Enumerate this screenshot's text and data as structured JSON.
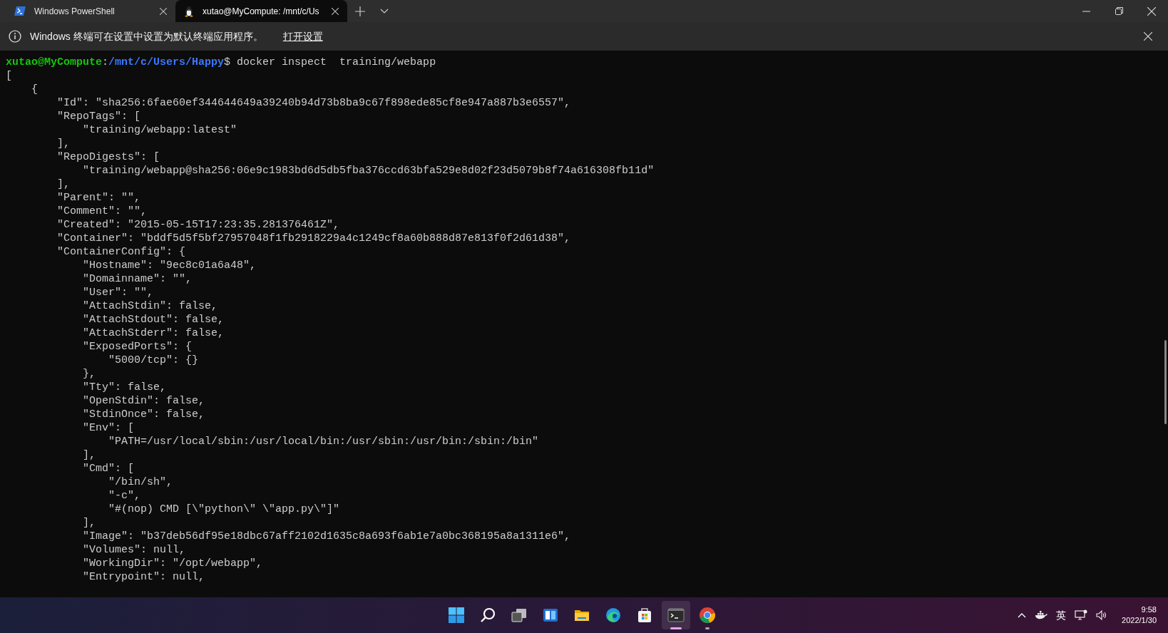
{
  "tabs": [
    {
      "kind": "powershell",
      "title": "Windows PowerShell",
      "selected": false
    },
    {
      "kind": "linux",
      "title": "xutao@MyCompute: /mnt/c/Us",
      "selected": true
    }
  ],
  "info_bar": {
    "message": "Windows 终端可在设置中设置为默认终端应用程序。",
    "link": "打开设置"
  },
  "terminal": {
    "prompt": {
      "user": "xutao@MyCompute",
      "separator": ":",
      "path": "/mnt/c/Users/Happy",
      "command": "$ docker inspect  training/webapp"
    },
    "lines": [
      "[",
      "    {",
      "        \"Id\": \"sha256:6fae60ef344644649a39240b94d73b8ba9c67f898ede85cf8e947a887b3e6557\",",
      "        \"RepoTags\": [",
      "            \"training/webapp:latest\"",
      "        ],",
      "        \"RepoDigests\": [",
      "            \"training/webapp@sha256:06e9c1983bd6d5db5fba376ccd63bfa529e8d02f23d5079b8f74a616308fb11d\"",
      "        ],",
      "        \"Parent\": \"\",",
      "        \"Comment\": \"\",",
      "        \"Created\": \"2015-05-15T17:23:35.281376461Z\",",
      "        \"Container\": \"bddf5d5f5bf27957048f1fb2918229a4c1249cf8a60b888d87e813f0f2d61d38\",",
      "        \"ContainerConfig\": {",
      "            \"Hostname\": \"9ec8c01a6a48\",",
      "            \"Domainname\": \"\",",
      "            \"User\": \"\",",
      "            \"AttachStdin\": false,",
      "            \"AttachStdout\": false,",
      "            \"AttachStderr\": false,",
      "            \"ExposedPorts\": {",
      "                \"5000/tcp\": {}",
      "            },",
      "            \"Tty\": false,",
      "            \"OpenStdin\": false,",
      "            \"StdinOnce\": false,",
      "            \"Env\": [",
      "                \"PATH=/usr/local/sbin:/usr/local/bin:/usr/sbin:/usr/bin:/sbin:/bin\"",
      "            ],",
      "            \"Cmd\": [",
      "                \"/bin/sh\",",
      "                \"-c\",",
      "                \"#(nop) CMD [\\\"python\\\" \\\"app.py\\\"]\"",
      "            ],",
      "            \"Image\": \"b37deb56df95e18dbc67aff2102d1635c8a693f6ab1e7a0bc368195a8a1311e6\",",
      "            \"Volumes\": null,",
      "            \"WorkingDir\": \"/opt/webapp\",",
      "            \"Entrypoint\": null,"
    ]
  },
  "taskbar": {
    "apps": [
      {
        "kind": "start",
        "running": false,
        "selected": false
      },
      {
        "kind": "search",
        "running": false,
        "selected": false
      },
      {
        "kind": "taskview",
        "running": false,
        "selected": false
      },
      {
        "kind": "widgets",
        "running": false,
        "selected": false
      },
      {
        "kind": "explorer",
        "running": false,
        "selected": false
      },
      {
        "kind": "edge",
        "running": false,
        "selected": false
      },
      {
        "kind": "store",
        "running": false,
        "selected": false
      },
      {
        "kind": "terminal",
        "running": true,
        "selected": true
      },
      {
        "kind": "chrome",
        "running": true,
        "selected": false
      }
    ],
    "input_method": "英",
    "time": "9:58",
    "date": "2022/1/30"
  }
}
